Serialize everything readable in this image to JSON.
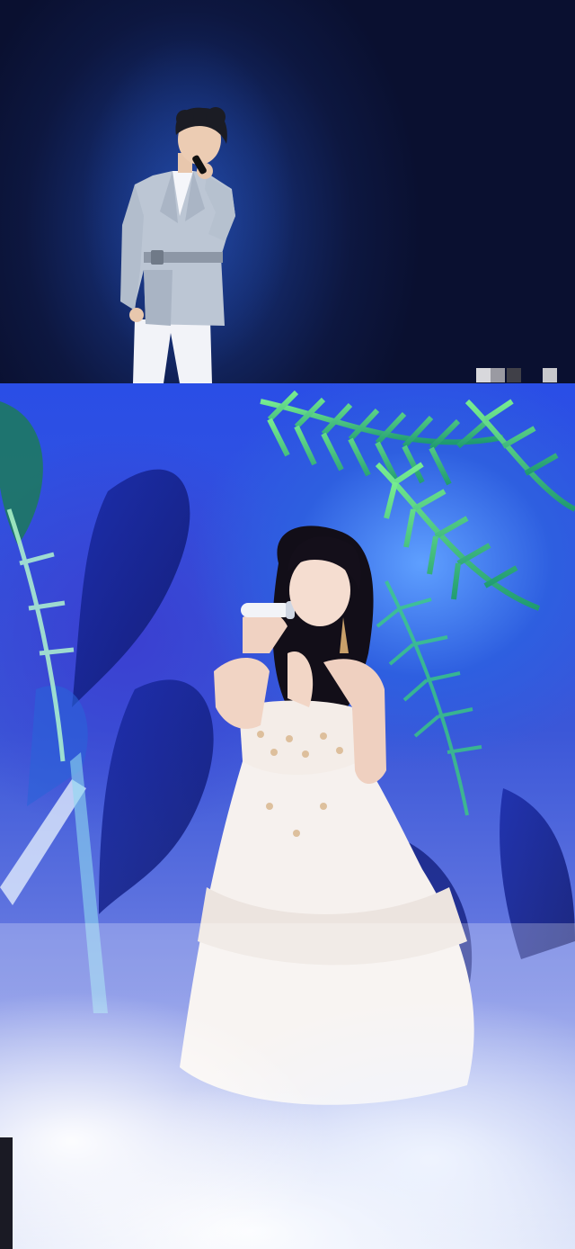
{
  "images": [
    {
      "name": "top-photo",
      "icon": "singer-suit-on-stage",
      "background": "#0c1438"
    },
    {
      "name": "bottom-photo",
      "icon": "singer-white-gown-jungle-stage",
      "background": "#2f55e0"
    }
  ],
  "colors": {
    "stage_dark": "#0a0f2a",
    "stage_blue": "#2a4ee6",
    "leaf_green": "#45d86a",
    "fog_white": "#f3f6ff"
  }
}
